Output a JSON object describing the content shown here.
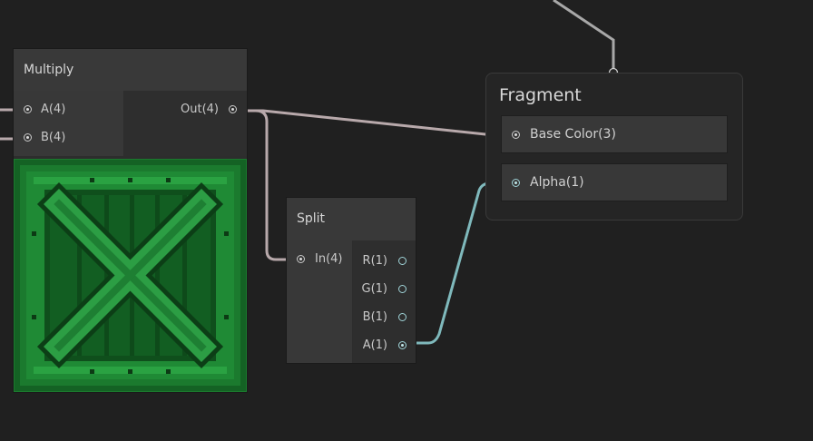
{
  "colors": {
    "background": "#202020",
    "node_body": "#2d2d2d",
    "node_header": "#393939",
    "wire_vector": "#b8a9ab",
    "wire_float": "#7fb9bc",
    "wire_context": "#a8a8a8",
    "preview_green": "#18702a"
  },
  "multiply": {
    "title": "Multiply",
    "inputs": [
      {
        "label": "A(4)"
      },
      {
        "label": "B(4)"
      }
    ],
    "outputs": [
      {
        "label": "Out(4)"
      }
    ],
    "preview_icon": "wooden-crate-preview"
  },
  "split": {
    "title": "Split",
    "inputs": [
      {
        "label": "In(4)"
      }
    ],
    "outputs": [
      {
        "label": "R(1)"
      },
      {
        "label": "G(1)"
      },
      {
        "label": "B(1)"
      },
      {
        "label": "A(1)"
      }
    ]
  },
  "fragment": {
    "title": "Fragment",
    "ports": [
      {
        "label": "Base Color(3)"
      },
      {
        "label": "Alpha(1)"
      }
    ]
  }
}
